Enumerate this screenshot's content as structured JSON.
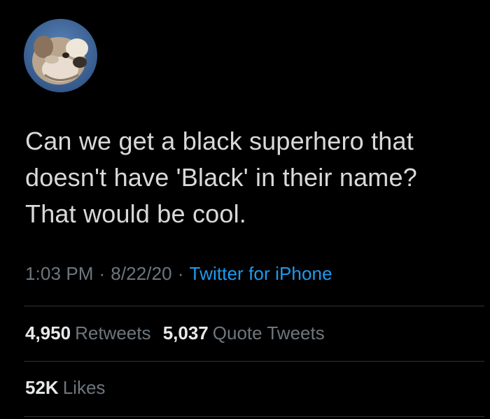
{
  "tweet": {
    "avatar_icon": "bulldog-avatar-icon",
    "text_lines": [
      "Can we get a black superhero that",
      "doesn't have 'Black' in their name?",
      "That would be cool."
    ],
    "time": "1:03 PM",
    "separator": "·",
    "date": "8/22/20",
    "source": "Twitter for iPhone"
  },
  "stats": {
    "retweets": {
      "count": "4,950",
      "label": "Retweets"
    },
    "quote_tweets": {
      "count": "5,037",
      "label": "Quote Tweets"
    },
    "likes": {
      "count": "52K",
      "label": "Likes"
    }
  },
  "colors": {
    "background": "#000000",
    "text": "#d9d9d9",
    "muted": "#6e767d",
    "link": "#1d9bf0",
    "divider": "#2f3336"
  }
}
